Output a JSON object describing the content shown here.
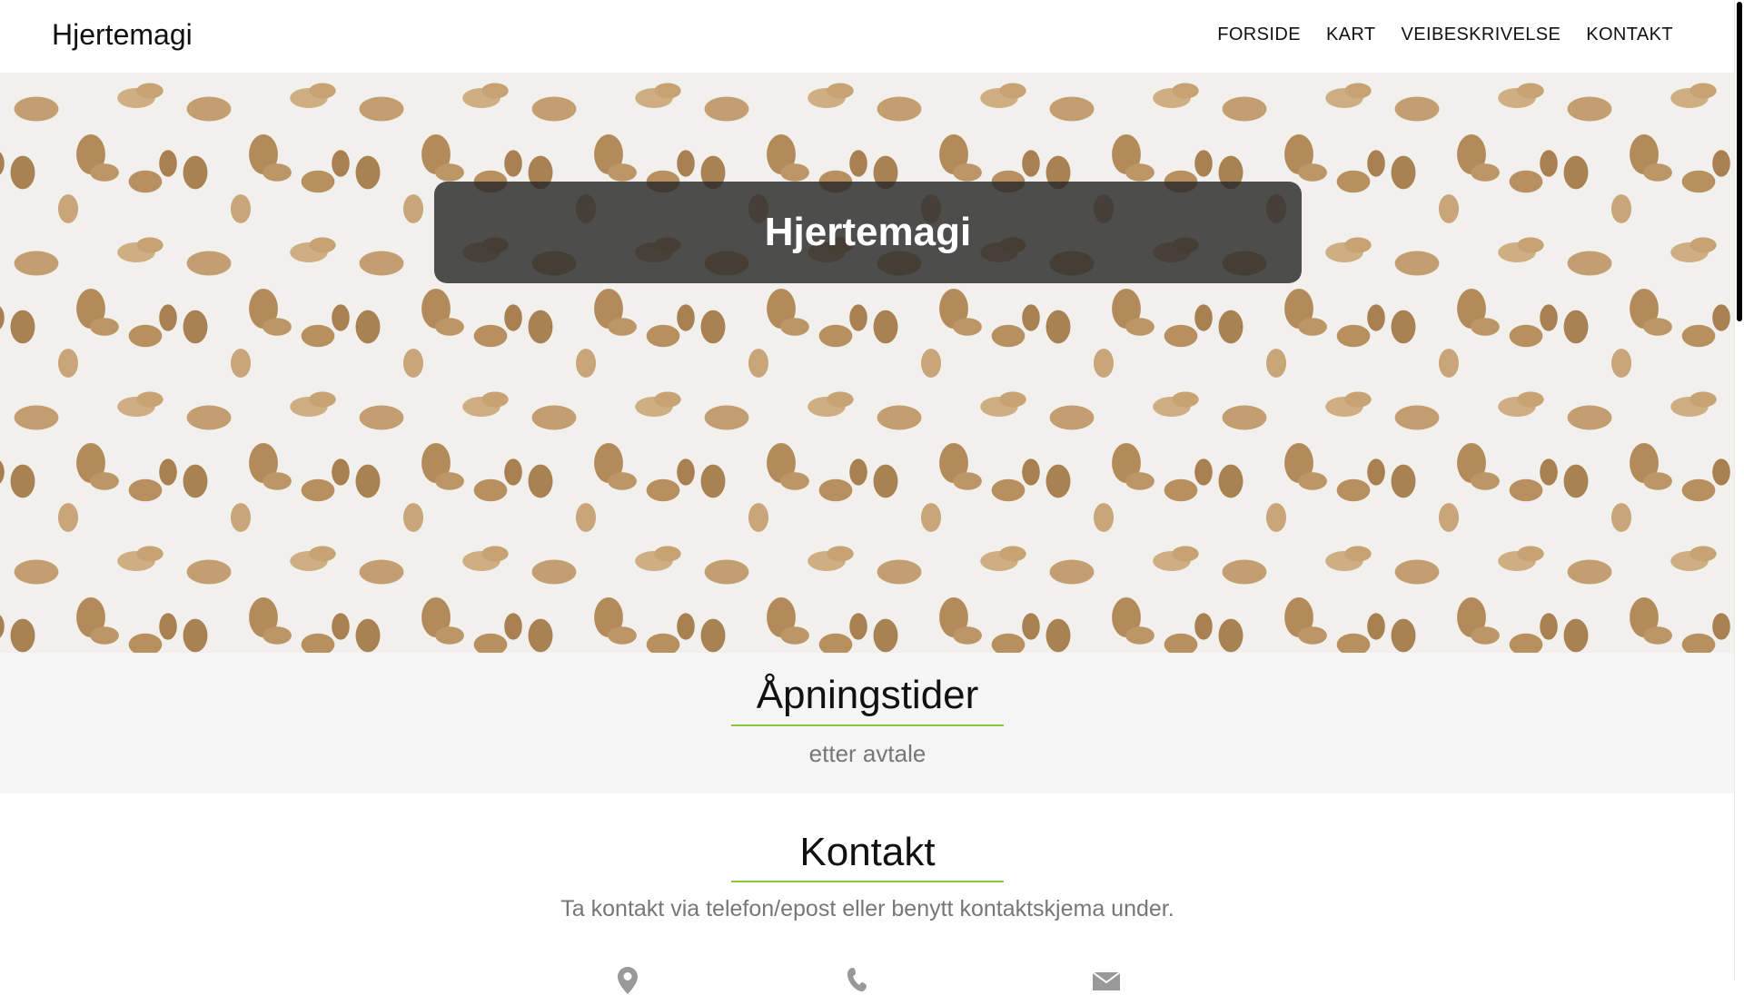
{
  "navbar": {
    "brand": "Hjertemagi",
    "links": [
      "FORSIDE",
      "KART",
      "VEIBESKRIVELSE",
      "KONTAKT"
    ]
  },
  "hero": {
    "title": "Hjertemagi"
  },
  "hours": {
    "title": "Åpningstider",
    "text": "etter avtale"
  },
  "contact": {
    "title": "Kontakt",
    "text": "Ta kontakt via telefon/epost eller benytt kontaktskjema under.",
    "icons": [
      "map-marker-icon",
      "phone-icon",
      "envelope-icon"
    ]
  },
  "colors": {
    "accent_underline": "#8cc63f",
    "hero_overlay": "#282828",
    "section_bg": "#f5f5f5",
    "muted_text": "#777777"
  }
}
